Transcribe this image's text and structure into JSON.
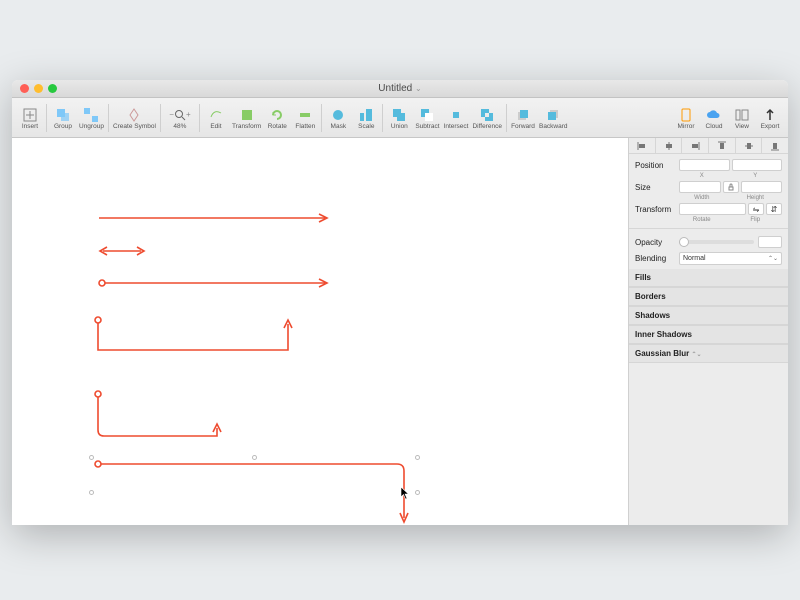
{
  "window": {
    "title": "Untitled"
  },
  "toolbar": {
    "insert": "Insert",
    "group": "Group",
    "ungroup": "Ungroup",
    "create_symbol": "Create Symbol",
    "zoom": "48%",
    "edit": "Edit",
    "transform": "Transform",
    "rotate": "Rotate",
    "flatten": "Flatten",
    "mask": "Mask",
    "scale": "Scale",
    "union": "Union",
    "subtract": "Subtract",
    "intersect": "Intersect",
    "difference": "Difference",
    "forward": "Forward",
    "backward": "Backward",
    "mirror": "Mirror",
    "cloud": "Cloud",
    "view": "View",
    "export": "Export"
  },
  "inspector": {
    "position": "Position",
    "size": "Size",
    "transform": "Transform",
    "x": "X",
    "y": "Y",
    "width": "Width",
    "height": "Height",
    "rotate": "Rotate",
    "flip": "Flip",
    "opacity": "Opacity",
    "blending": "Blending",
    "blending_mode": "Normal",
    "fills": "Fills",
    "borders": "Borders",
    "shadows": "Shadows",
    "inner_shadows": "Inner Shadows",
    "gaussian_blur": "Gaussian Blur"
  },
  "colors": {
    "arrow": "#ee4b2f"
  }
}
